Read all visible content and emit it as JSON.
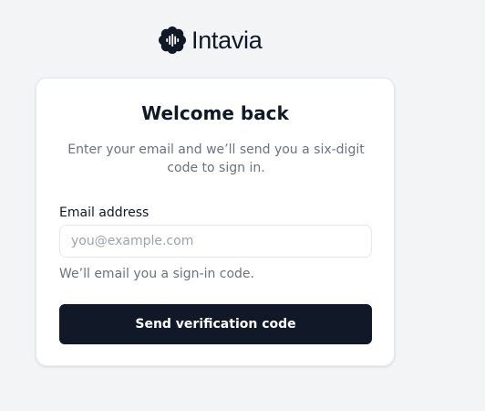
{
  "brand": {
    "name": "Intavia",
    "icon": "waveform-flower-icon",
    "color": "#111827"
  },
  "login": {
    "title": "Welcome back",
    "subtitle": "Enter your email and we’ll send you a six-digit code to sign in.",
    "email_label": "Email address",
    "email_value": "",
    "email_placeholder": "you@example.com",
    "helper_text": "We’ll email you a sign-in code.",
    "submit_label": "Send verification code"
  },
  "colors": {
    "background": "#f3f4f6",
    "card": "#ffffff",
    "button": "#111827",
    "muted_text": "#6b7280"
  }
}
